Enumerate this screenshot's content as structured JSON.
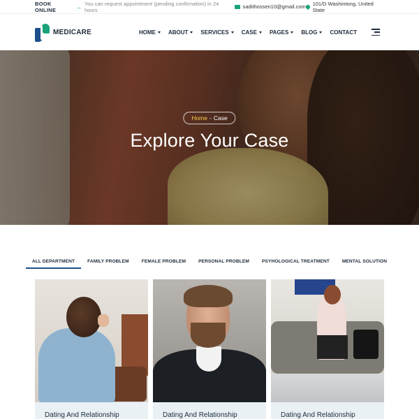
{
  "topbar": {
    "book_label": "BOOK ONLINE",
    "note": "You can request appointment (pending confirmation) in 24 hours",
    "email": "sadithossen10@gmail.com",
    "address": "101/D Washintong, United State"
  },
  "header": {
    "logo_text": "MEDICARE",
    "nav": [
      {
        "label": "HOME"
      },
      {
        "label": "ABOUT"
      },
      {
        "label": "SERVICES"
      },
      {
        "label": "CASE"
      },
      {
        "label": "PAGES"
      },
      {
        "label": "BLOG"
      },
      {
        "label": "CONTACT"
      }
    ]
  },
  "hero": {
    "breadcrumb_home": "Home",
    "breadcrumb_sep": "-",
    "breadcrumb_current": "Case",
    "title": "Explore Your Case"
  },
  "tabs": [
    {
      "label": "ALL DEPARTMENT",
      "active": true
    },
    {
      "label": "FAMILY PROBLEM",
      "active": false
    },
    {
      "label": "FEMALE PROBLEM",
      "active": false
    },
    {
      "label": "PERSONAL PROBLEM",
      "active": false
    },
    {
      "label": "PSYHOLOGICAL TREATMENT",
      "active": false
    },
    {
      "label": "MENTAL SOLUTION",
      "active": false
    }
  ],
  "cards": [
    {
      "caption": "Dating And Relationship"
    },
    {
      "caption": "Dating And Relationship"
    },
    {
      "caption": "Dating And Relationship"
    }
  ],
  "colors": {
    "accent_green": "#1aa37a",
    "brand_blue": "#1c4f8c",
    "breadcrumb_home": "#f2c94c",
    "card_caption_bg": "#e9f1f4"
  }
}
